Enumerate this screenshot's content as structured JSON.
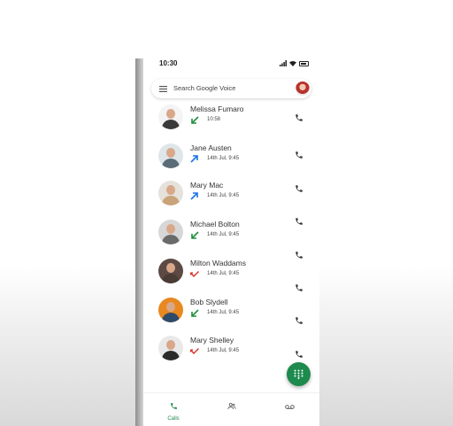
{
  "status_bar": {
    "time": "10:30"
  },
  "search": {
    "placeholder": "Search Google Voice"
  },
  "calls": [
    {
      "name": "Melissa Fumaro",
      "time": "10:58",
      "type": "incoming",
      "color": "#1e8e3e",
      "shirt": "#3a3a3a",
      "bg": "#f4f4f4"
    },
    {
      "name": "Jane Austen",
      "time": "14th Jul, 9:45",
      "type": "outgoing",
      "color": "#1a73e8",
      "shirt": "#5b6b78",
      "bg": "#dfe6ea"
    },
    {
      "name": "Mary Mac",
      "time": "14th Jul, 9:45",
      "type": "outgoing",
      "color": "#1a73e8",
      "shirt": "#c9a37a",
      "bg": "#e6e1db"
    },
    {
      "name": "Michael Bolton",
      "time": "14th Jul, 9:45",
      "type": "incoming",
      "color": "#1e8e3e",
      "shirt": "#6a6a6a",
      "bg": "#d7d7d7"
    },
    {
      "name": "Milton Waddams",
      "time": "14th Jul, 9:45",
      "type": "missed",
      "color": "#d93025",
      "shirt": "#4a3b35",
      "bg": "#5d4a44"
    },
    {
      "name": "Bob Slydell",
      "time": "14th Jul, 9:45",
      "type": "incoming",
      "color": "#1e8e3e",
      "shirt": "#2e4a6b",
      "bg": "#e8881f"
    },
    {
      "name": "Mary Shelley",
      "time": "14th Jul, 9:45",
      "type": "missed",
      "color": "#d93025",
      "shirt": "#2b2b2b",
      "bg": "#e9e9e9"
    }
  ],
  "nav": {
    "calls_label": "Calls"
  },
  "colors": {
    "accent": "#1d8a4e"
  }
}
